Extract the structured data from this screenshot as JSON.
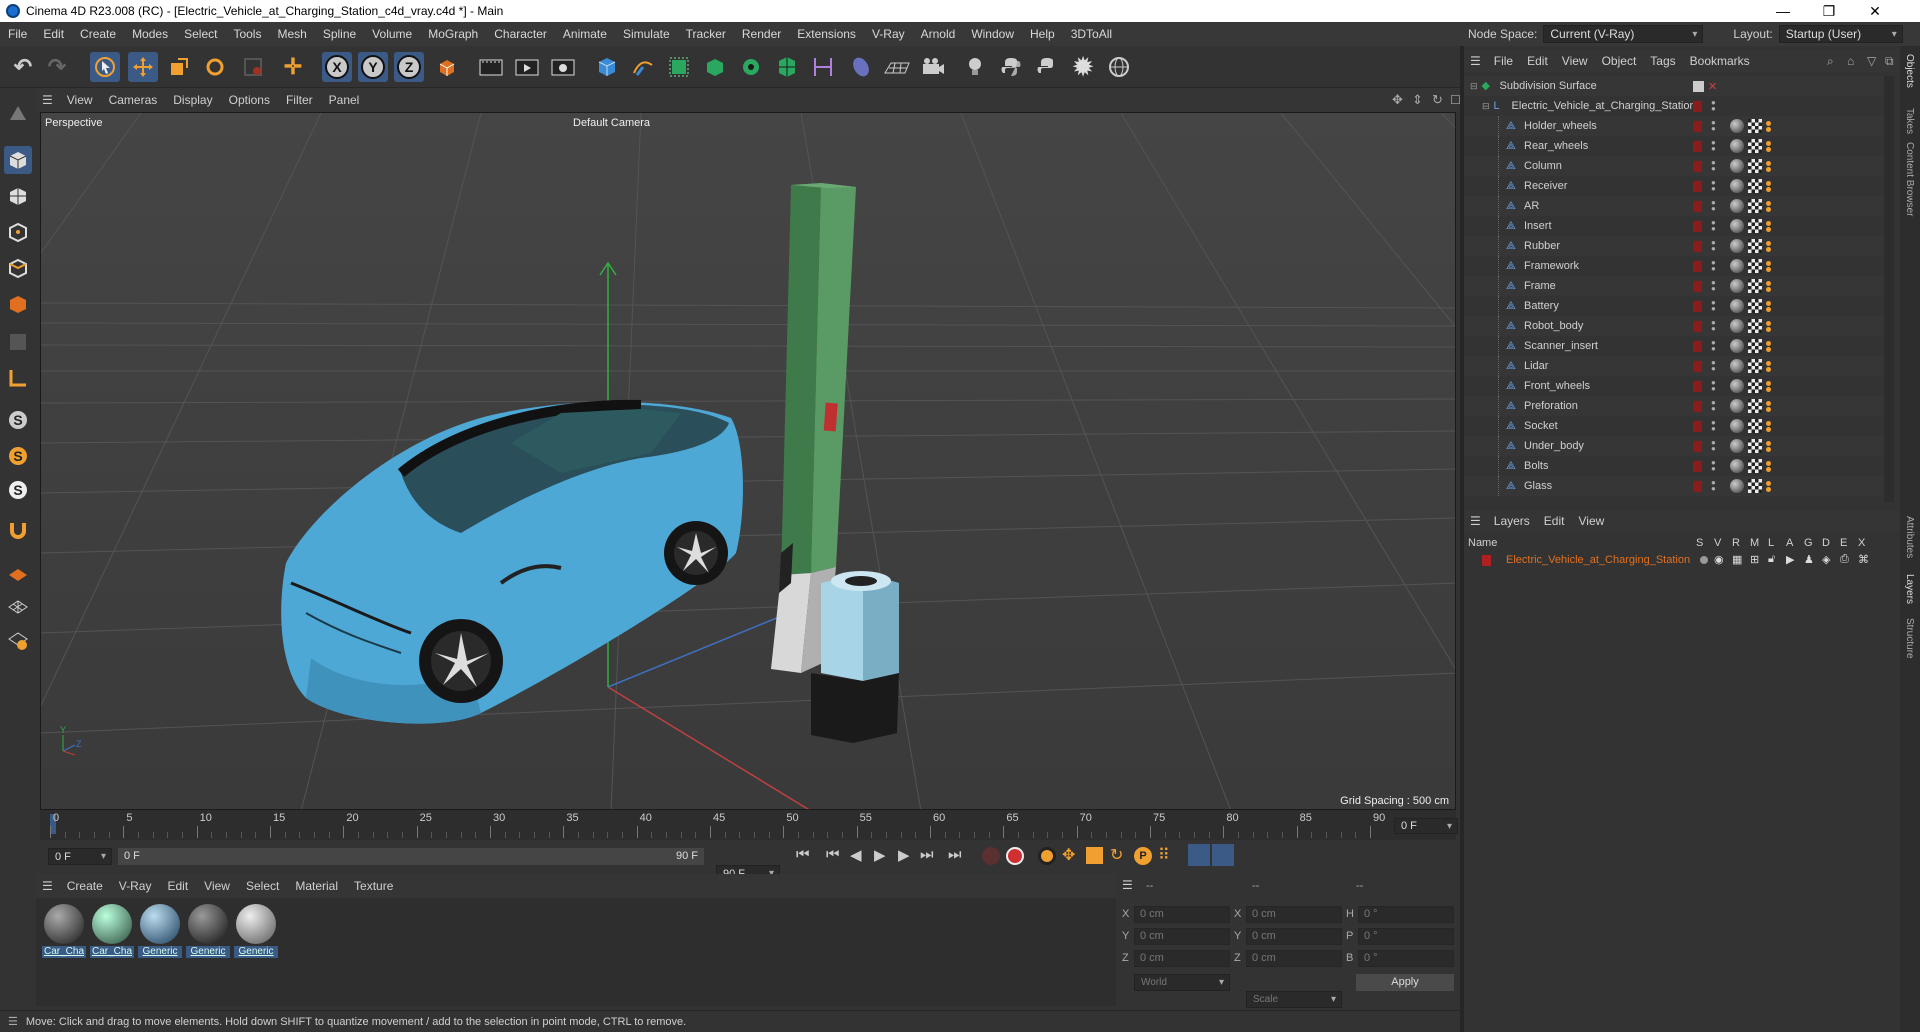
{
  "window": {
    "title": "Cinema 4D R23.008 (RC) - [Electric_Vehicle_at_Charging_Station_c4d_vray.c4d *] - Main",
    "controls": [
      "—",
      "❐",
      "✕"
    ]
  },
  "menubar": [
    "File",
    "Edit",
    "Create",
    "Modes",
    "Select",
    "Tools",
    "Mesh",
    "Spline",
    "Volume",
    "MoGraph",
    "Character",
    "Animate",
    "Simulate",
    "Tracker",
    "Render",
    "Extensions",
    "V-Ray",
    "Arnold",
    "Window",
    "Help",
    "3DToAll"
  ],
  "nodespace": {
    "label": "Node Space:",
    "value": "Current (V-Ray)",
    "layout_label": "Layout:",
    "layout_value": "Startup (User)"
  },
  "toolbar": {
    "axes": [
      "X",
      "Y",
      "Z"
    ]
  },
  "viewport": {
    "menu": [
      "View",
      "Cameras",
      "Display",
      "Options",
      "Filter",
      "Panel"
    ],
    "label": "Perspective",
    "camera": "Default Camera",
    "grid_spacing": "Grid Spacing : 500 cm",
    "axis_y": "Y",
    "axis_z": "Z"
  },
  "timeline": {
    "ticks": [
      "0",
      "5",
      "10",
      "15",
      "20",
      "25",
      "30",
      "35",
      "40",
      "45",
      "50",
      "55",
      "60",
      "65",
      "70",
      "75",
      "80",
      "85",
      "90"
    ],
    "current_frame": "0 F",
    "end_frame_display": "0 F"
  },
  "timecontrols": {
    "start": "0 F",
    "range_start": "0 F",
    "range_end": "90 F",
    "end": "90 F"
  },
  "materials": {
    "menu": [
      "Create",
      "V-Ray",
      "Edit",
      "View",
      "Select",
      "Material",
      "Texture"
    ],
    "items": [
      {
        "label": "Car_Cha",
        "color": "#4a4e55"
      },
      {
        "label": "Car_Cha",
        "color": "#5a7a6a"
      },
      {
        "label": "Generic",
        "color": "#3a5a7a"
      },
      {
        "label": "Generic",
        "color": "#444"
      },
      {
        "label": "Generic",
        "color": "#8a8a8a"
      }
    ]
  },
  "coordinates": {
    "header": [
      "--",
      "--",
      "--"
    ],
    "rows": [
      {
        "a": "X",
        "av": "0 cm",
        "b": "X",
        "bv": "0 cm",
        "c": "H",
        "cv": "0 °"
      },
      {
        "a": "Y",
        "av": "0 cm",
        "b": "Y",
        "bv": "0 cm",
        "c": "P",
        "cv": "0 °"
      },
      {
        "a": "Z",
        "av": "0 cm",
        "b": "Z",
        "bv": "0 cm",
        "c": "B",
        "cv": "0 °"
      }
    ],
    "mode": "World",
    "scale": "Scale",
    "apply": "Apply"
  },
  "status": "Move: Click and drag to move elements. Hold down SHIFT to quantize movement / add to the selection in point mode, CTRL to remove.",
  "objects": {
    "menu": [
      "File",
      "Edit",
      "View",
      "Object",
      "Tags",
      "Bookmarks"
    ],
    "root": "Subdivision Surface",
    "group": "Electric_Vehicle_at_Charging_Station",
    "children": [
      "Holder_wheels",
      "Rear_wheels",
      "Column",
      "Receiver",
      "AR",
      "Insert",
      "Rubber",
      "Framework",
      "Frame",
      "Battery",
      "Robot_body",
      "Scanner_insert",
      "Lidar",
      "Front_wheels",
      "Preforation",
      "Socket",
      "Under_body",
      "Bolts",
      "Glass"
    ]
  },
  "layers": {
    "menu": [
      "Layers",
      "Edit",
      "View"
    ],
    "name_header": "Name",
    "columns": [
      "S",
      "V",
      "R",
      "M",
      "L",
      "A",
      "G",
      "D",
      "E",
      "X"
    ],
    "items": [
      "Electric_Vehicle_at_Charging_Station"
    ]
  },
  "side_tabs": [
    "Objects",
    "Takes",
    "Content Browser",
    "Attributes",
    "Layers",
    "Structure"
  ]
}
